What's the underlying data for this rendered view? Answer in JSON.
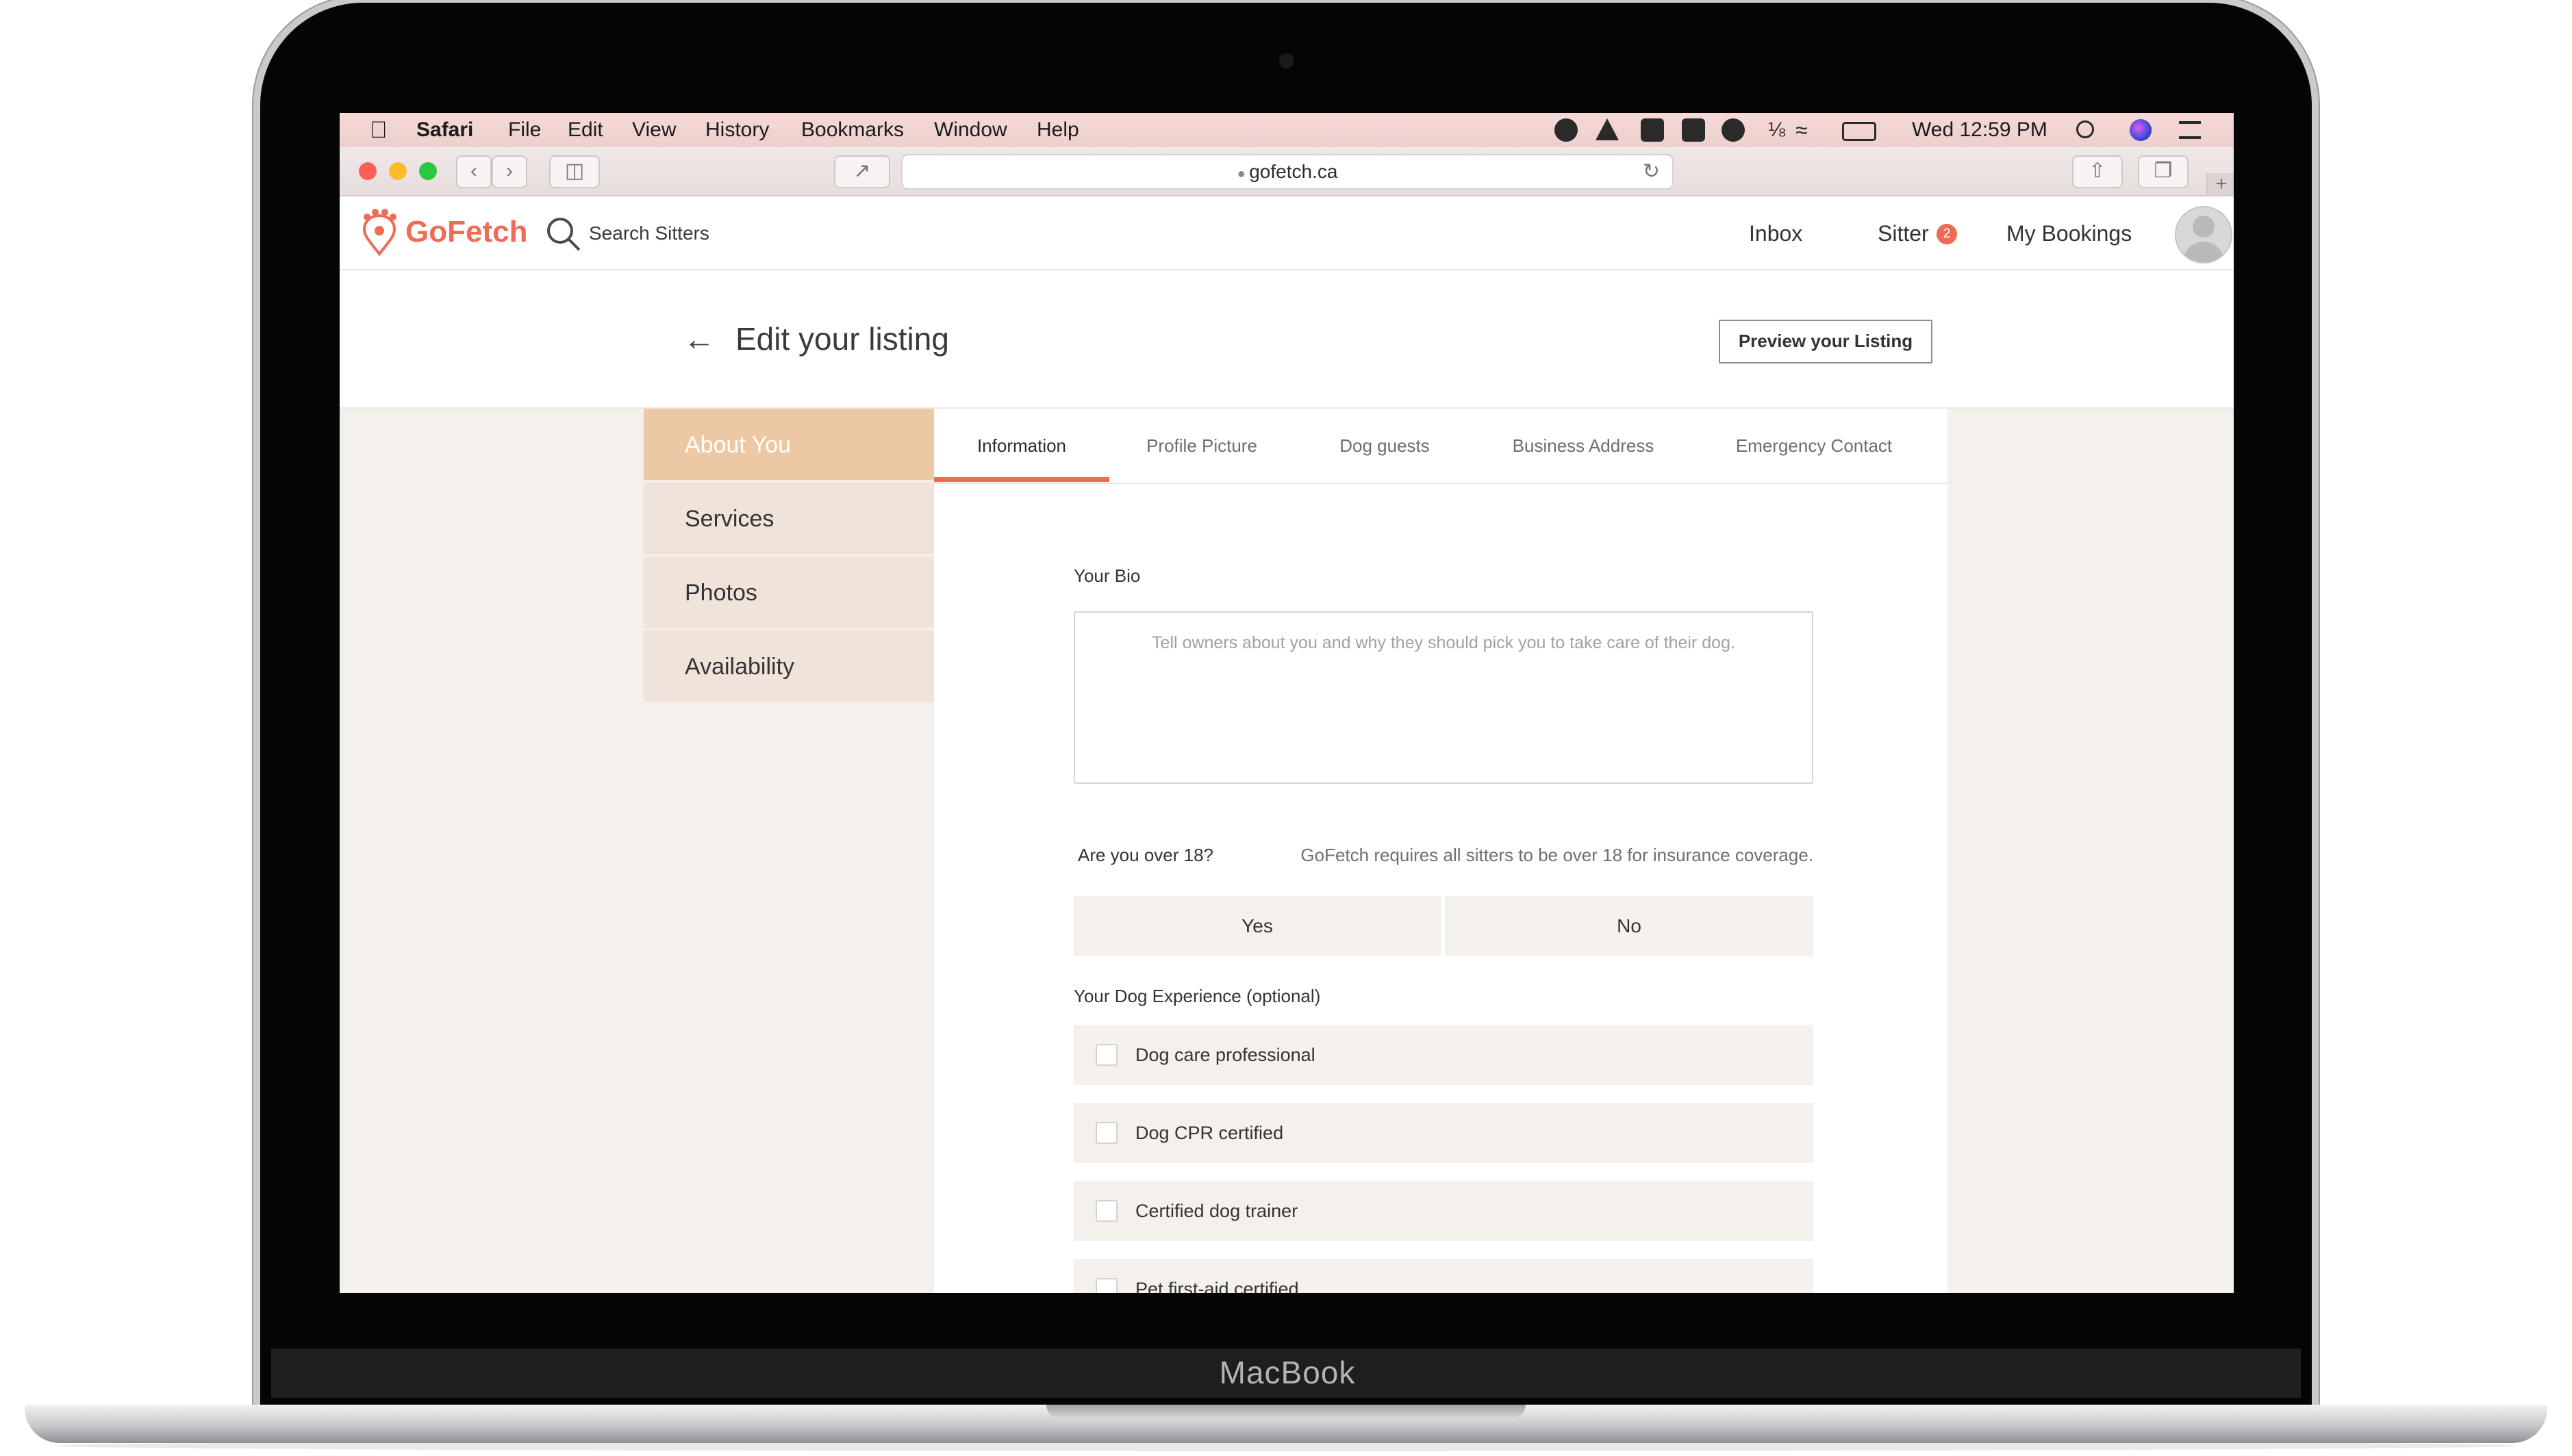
{
  "device": {
    "brand": "MacBook"
  },
  "menubar": {
    "app": "Safari",
    "items": [
      "File",
      "Edit",
      "View",
      "History",
      "Bookmarks",
      "Window",
      "Help"
    ],
    "clock": "Wed 12:59 PM"
  },
  "browser": {
    "url": "gofetch.ca"
  },
  "header": {
    "logo": "GoFetch",
    "search_label": "Search Sitters",
    "nav": {
      "inbox": "Inbox",
      "sitter": "Sitter",
      "sitter_badge": "2",
      "bookings": "My Bookings"
    }
  },
  "page": {
    "title": "Edit your listing",
    "preview_button": "Preview your Listing"
  },
  "sidebar": {
    "items": [
      {
        "label": "About You",
        "active": true
      },
      {
        "label": "Services"
      },
      {
        "label": "Photos"
      },
      {
        "label": "Availability"
      }
    ]
  },
  "tabs": [
    "Information",
    "Profile Picture",
    "Dog guests",
    "Business Address",
    "Emergency Contact"
  ],
  "form": {
    "bio_label": "Your Bio",
    "bio_placeholder": "Tell owners about you and why they should pick you to take care of their dog.",
    "age_question": "Are you over 18?",
    "age_note": "GoFetch requires all sitters to be over 18 for insurance coverage.",
    "yes_label": "Yes",
    "no_label": "No",
    "experience_label": "Your Dog Experience (optional)",
    "experience_options": [
      "Dog care professional",
      "Dog CPR certified",
      "Certified dog trainer",
      "Pet first-aid certified"
    ]
  },
  "colors": {
    "brand": "#ef6b55",
    "sidebar_active": "#ecc9a4",
    "panel_bg": "#f4f0ec"
  }
}
